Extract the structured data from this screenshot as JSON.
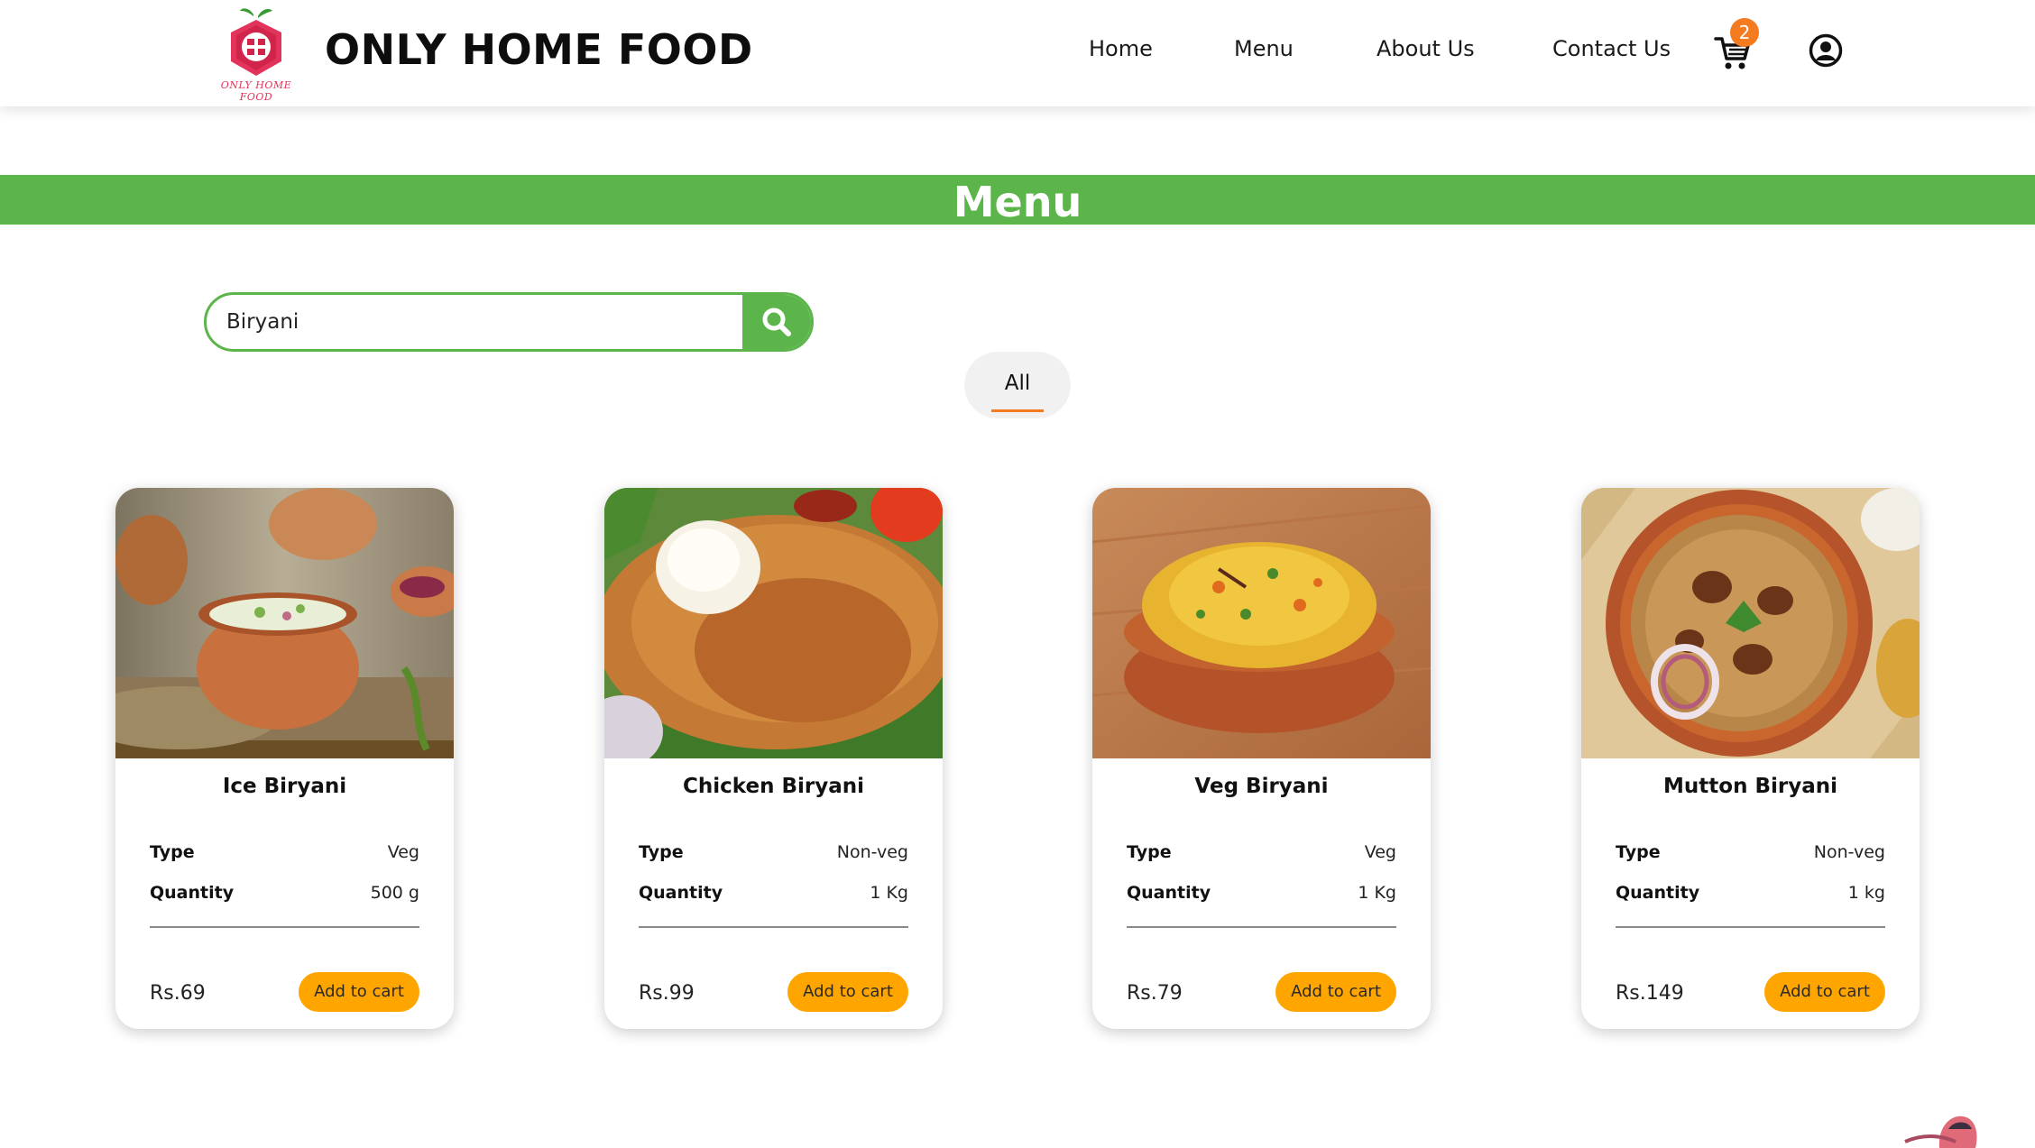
{
  "header": {
    "logo_tagline": "ONLY HOME FOOD",
    "brand": "ONLY HOME FOOD",
    "nav": [
      "Home",
      "Menu",
      "About Us",
      "Contact Us"
    ],
    "cart_count": "2",
    "cart_icon": "cart-icon",
    "profile_icon": "user-circle-icon"
  },
  "page_title": "Menu",
  "search": {
    "value": "Biryani",
    "icon": "search-icon"
  },
  "filter": {
    "label": "All"
  },
  "labels": {
    "type": "Type",
    "quantity": "Quantity",
    "add_to_cart": "Add to cart"
  },
  "products": [
    {
      "name": "Ice Biryani",
      "type": "Veg",
      "quantity": "500 g",
      "price": "Rs.69"
    },
    {
      "name": "Chicken Biryani",
      "type": "Non-veg",
      "quantity": "1 Kg",
      "price": "Rs.99"
    },
    {
      "name": "Veg Biryani",
      "type": "Veg",
      "quantity": "1 Kg",
      "price": "Rs.79"
    },
    {
      "name": "Mutton Biryani",
      "type": "Non-veg",
      "quantity": "1 kg",
      "price": "Rs.149"
    }
  ],
  "colors": {
    "accent_green": "#5cb54a",
    "accent_orange": "#f47b20",
    "button_orange": "#ffa500",
    "logo_red": "#e2335a"
  }
}
